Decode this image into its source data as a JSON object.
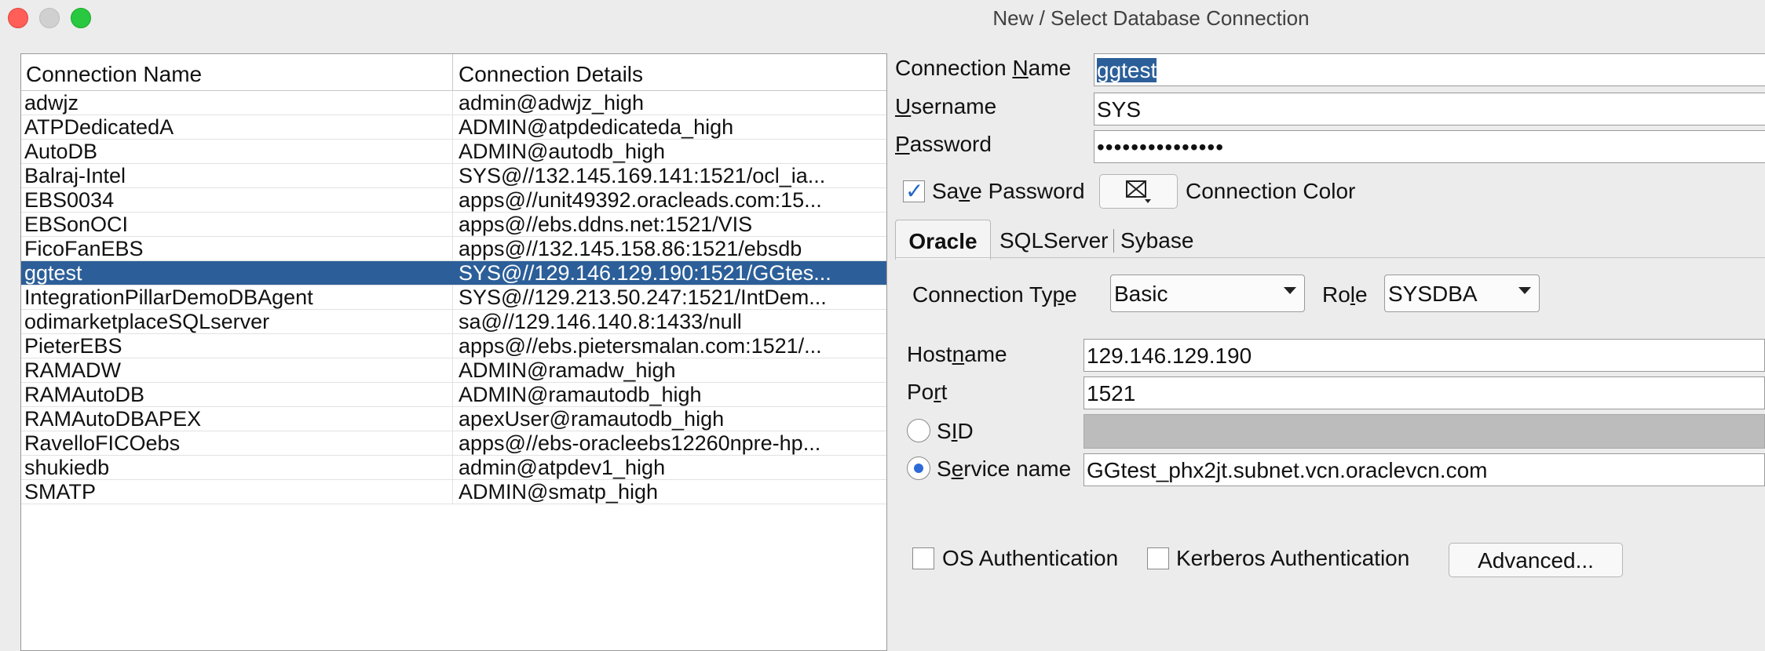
{
  "window": {
    "title": "New / Select Database Connection"
  },
  "table": {
    "headers": [
      "Connection Name",
      "Connection Details"
    ],
    "rows": [
      {
        "name": "adwjz",
        "details": "admin@adwjz_high"
      },
      {
        "name": "ATPDedicatedA",
        "details": "ADMIN@atpdedicateda_high"
      },
      {
        "name": "AutoDB",
        "details": "ADMIN@autodb_high"
      },
      {
        "name": "Balraj-Intel",
        "details": "SYS@//132.145.169.141:1521/ocl_ia..."
      },
      {
        "name": "EBS0034",
        "details": "apps@//unit49392.oracleads.com:15..."
      },
      {
        "name": "EBSonOCI",
        "details": "apps@//ebs.ddns.net:1521/VIS"
      },
      {
        "name": "FicoFanEBS",
        "details": "apps@//132.145.158.86:1521/ebsdb"
      },
      {
        "name": "ggtest",
        "details": "SYS@//129.146.129.190:1521/GGtes..."
      },
      {
        "name": "IntegrationPillarDemoDBAgent",
        "details": "SYS@//129.213.50.247:1521/IntDem..."
      },
      {
        "name": "odimarketplaceSQLserver",
        "details": "sa@//129.146.140.8:1433/null"
      },
      {
        "name": "PieterEBS",
        "details": "apps@//ebs.pietersmalan.com:1521/..."
      },
      {
        "name": "RAMADW",
        "details": "ADMIN@ramadw_high"
      },
      {
        "name": "RAMAutoDB",
        "details": "ADMIN@ramautodb_high"
      },
      {
        "name": "RAMAutoDBAPEX",
        "details": "apexUser@ramautodb_high"
      },
      {
        "name": "RavelloFICOebs",
        "details": "apps@//ebs-oracleebs12260npre-hp..."
      },
      {
        "name": "shukiedb",
        "details": "admin@atpdev1_high"
      },
      {
        "name": "SMATP",
        "details": "ADMIN@smatp_high"
      }
    ],
    "selected_name": "ggtest"
  },
  "form": {
    "connection_name": {
      "label_pre": "Connection ",
      "label_u": "N",
      "label_post": "ame",
      "value": "ggtest"
    },
    "username": {
      "label_u": "U",
      "label_post": "sername",
      "value": "SYS"
    },
    "password": {
      "label_u": "P",
      "label_post": "assword",
      "value": "•••••••••••••••"
    },
    "save_password": {
      "label_pre": "Sa",
      "label_u": "v",
      "label_post": "e Password",
      "checked": true
    },
    "connection_color": {
      "label": "Connection Color",
      "icon": "color-picker-icon"
    },
    "tabs": [
      "Oracle",
      "SQLServer",
      "Sybase"
    ],
    "active_tab": "Oracle",
    "connection_type": {
      "label_pre": "Connection Ty",
      "label_u": "p",
      "label_post": "e",
      "value": "Basic"
    },
    "role": {
      "label_pre": "Ro",
      "label_u": "l",
      "label_post": "e",
      "value": "SYSDBA"
    },
    "hostname": {
      "label_pre": "Host",
      "label_u": "n",
      "label_post": "ame",
      "value": "129.146.129.190"
    },
    "port": {
      "label_pre": "Po",
      "label_u": "r",
      "label_post": "t",
      "value": "1521"
    },
    "sid": {
      "label_pre": "S",
      "label_u": "I",
      "label_post": "D",
      "value": "",
      "selected": false
    },
    "service_name": {
      "label_pre": "S",
      "label_u": "e",
      "label_post": "rvice name",
      "value": "GGtest_phx2jt.subnet.vcn.oraclevcn.com",
      "selected": true
    },
    "os_auth": {
      "label": "OS Authentication",
      "checked": false
    },
    "kerberos_auth": {
      "label": "Kerberos Authentication",
      "checked": false
    },
    "advanced_button": "Advanced..."
  }
}
